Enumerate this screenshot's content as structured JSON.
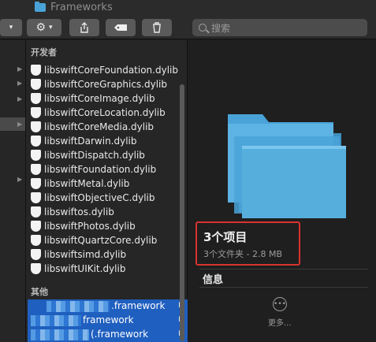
{
  "window": {
    "title": "Frameworks"
  },
  "toolbar": {
    "share_icon": "share-icon",
    "tag_icon": "tag-icon",
    "trash_icon": "trash-icon",
    "search_placeholder": "搜索"
  },
  "middle": {
    "section_developer": "开发者",
    "files": [
      "libswiftCoreFoundation.dylib",
      "libswiftCoreGraphics.dylib",
      "libswiftCoreImage.dylib",
      "libswiftCoreLocation.dylib",
      "libswiftCoreMedia.dylib",
      "libswiftDarwin.dylib",
      "libswiftDispatch.dylib",
      "libswiftFoundation.dylib",
      "libswiftMetal.dylib",
      "libswiftObjectiveC.dylib",
      "libswiftos.dylib",
      "libswiftPhotos.dylib",
      "libswiftQuartzCore.dylib",
      "libswiftsimd.dylib",
      "libswiftUIKit.dylib"
    ],
    "section_other": "其他",
    "frameworks": [
      ".framework",
      "framework",
      "(.framework"
    ]
  },
  "preview": {
    "title": "3个项目",
    "subtitle": "3个文件夹 - 2.8 MB",
    "info": "信息",
    "more": "更多..."
  },
  "colors": {
    "folder": "#4aa3d8",
    "selection": "#1f5fbf",
    "highlight": "#d9322e"
  }
}
